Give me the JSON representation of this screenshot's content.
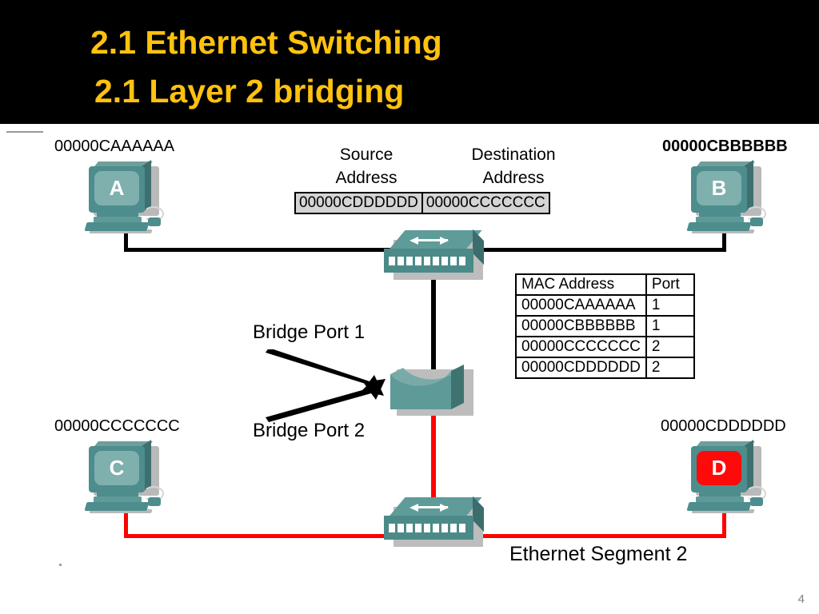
{
  "slide": {
    "title_line_1": "2.1 Ethernet Switching",
    "title_line_2": "2.1 Layer 2 bridging",
    "number": "4",
    "title_color": "#FFC20E",
    "band_color": "#000000",
    "accent_red": "#FF0000",
    "device_teal": "#4e8d8d"
  },
  "frame": {
    "source_heading": "Source\nAddress",
    "source_heading_line_1": "Source",
    "source_heading_line_2": "Address",
    "destination_heading_line_1": "Destination",
    "destination_heading_line_2": "Address",
    "source_address": "00000CDDDDDD",
    "destination_address": "00000CCCCCCC"
  },
  "hosts": [
    {
      "id": "a",
      "letter": "A",
      "mac": "00000CAAAAAA",
      "bold_label": false,
      "screen_alert": false,
      "cable_color": "#000000"
    },
    {
      "id": "b",
      "letter": "B",
      "mac": "00000CBBBBBB",
      "bold_label": true,
      "screen_alert": false,
      "cable_color": "#000000"
    },
    {
      "id": "c",
      "letter": "C",
      "mac": "00000CCCCCCC",
      "bold_label": false,
      "screen_alert": false,
      "cable_color": "#FF0000"
    },
    {
      "id": "d",
      "letter": "D",
      "mac": "00000CDDDDDD",
      "bold_label": false,
      "screen_alert": true,
      "cable_color": "#FF0000"
    }
  ],
  "mac_table": {
    "headers": [
      "MAC Address",
      "Port"
    ],
    "rows": [
      [
        "00000CAAAAAA",
        "1"
      ],
      [
        "00000CBBBBBB",
        "1"
      ],
      [
        "00000CCCCCCC",
        "2"
      ],
      [
        "00000CDDDDDD",
        "2"
      ]
    ]
  },
  "annotations": {
    "bridge_port_1": "Bridge Port 1",
    "bridge_port_2": "Bridge Port 2",
    "ethernet_segment_2": "Ethernet Segment 2"
  }
}
